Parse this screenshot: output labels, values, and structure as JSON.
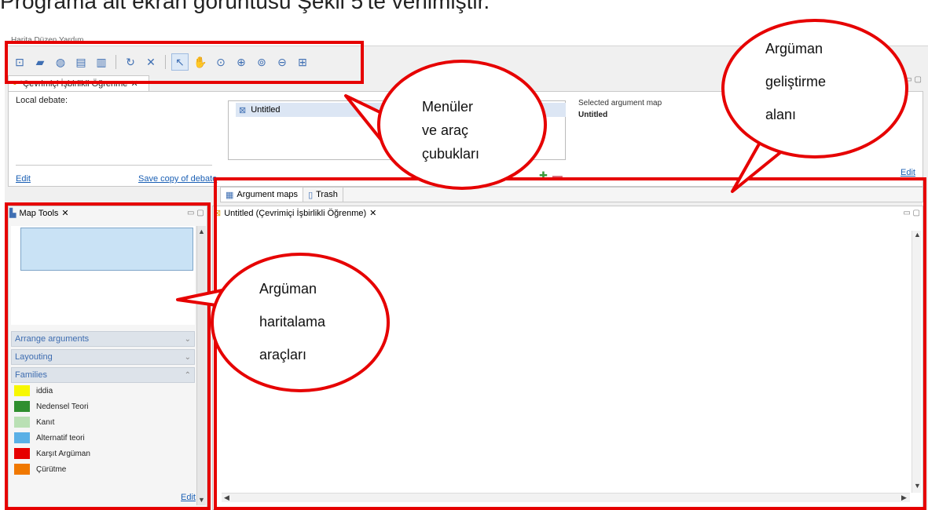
{
  "caption": "Programa ait ekran görüntüsü Şekil 5'te verilmiştir.",
  "menubar_text": "Harita  Düzen  Yardım",
  "toolbar": {
    "icons": [
      "new-map-icon",
      "open-folder-icon",
      "globe-icon",
      "copy-icon",
      "paste-icon",
      "refresh-icon",
      "tools-icon",
      "pointer-icon",
      "hand-icon",
      "zoom-fit-icon",
      "zoom-in-icon",
      "zoom-region-icon",
      "zoom-out-icon",
      "expand-icon"
    ]
  },
  "editor_tab": {
    "label": "*Çevrimiçi İşbirlikli Öğrenme"
  },
  "debate": {
    "local_debate_label": "Local debate:",
    "edit_label": "Edit",
    "save_copy_label": "Save copy of debate",
    "maps_item": "Untitled",
    "selected_map_label": "Selected argument map",
    "selected_map_title": "Untitled",
    "right_edit_label": "Edit"
  },
  "subtabs": [
    {
      "label": "Argument maps"
    },
    {
      "label": "Trash"
    }
  ],
  "map_tools": {
    "title": "Map Tools",
    "sections": [
      "Arrange arguments",
      "Layouting",
      "Families"
    ],
    "families": [
      {
        "label": "iddia",
        "color": "#f7f700"
      },
      {
        "label": "Nedensel Teori",
        "color": "#2f8f2f"
      },
      {
        "label": "Kanıt",
        "color": "#b9e0b4"
      },
      {
        "label": "Alternatif teori",
        "color": "#5ab0e6"
      },
      {
        "label": "Karşıt Argüman",
        "color": "#e60000"
      },
      {
        "label": "Çürütme",
        "color": "#f07800"
      }
    ],
    "edit_label": "Edit"
  },
  "canvas": {
    "tab_label": "Untitled (Çevrimiçi İşbirlikli Öğrenme)"
  },
  "annotations": {
    "menus": [
      "Menüler",
      "ve araç",
      "çubukları"
    ],
    "dev_area": [
      "Argüman",
      "geliştirme",
      "alanı"
    ],
    "mapping_tools": [
      "Argüman",
      "haritalama",
      "araçları"
    ]
  },
  "accent_color": "#e60000"
}
